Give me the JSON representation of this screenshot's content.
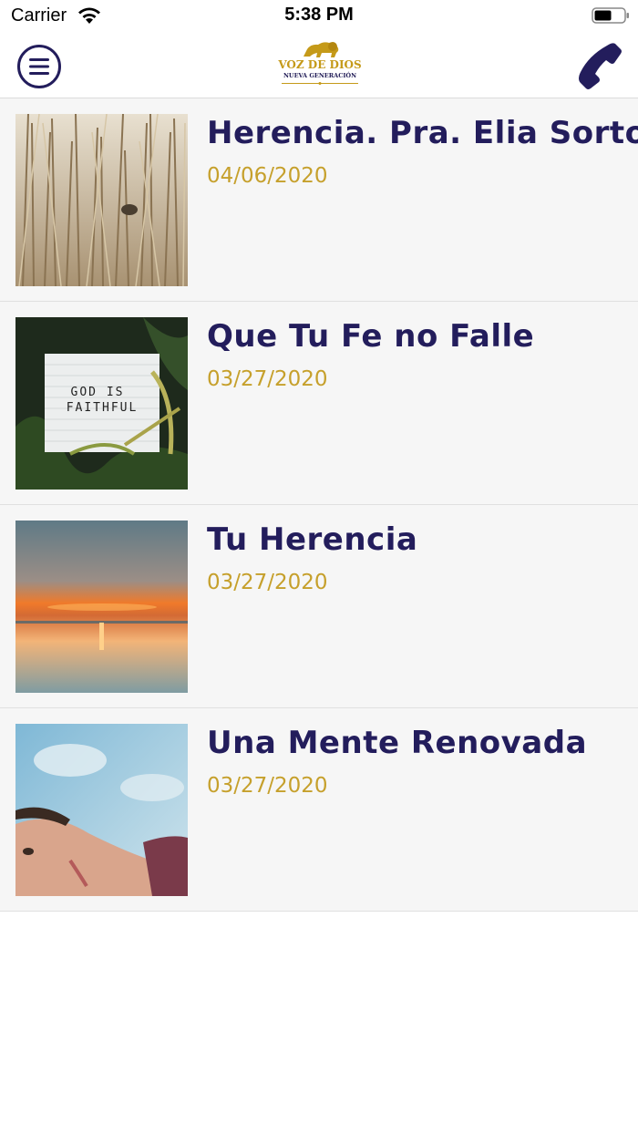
{
  "status_bar": {
    "carrier": "Carrier",
    "time": "5:38 PM"
  },
  "header": {
    "logo_line1": "VOZ DE DIOS",
    "logo_line2": "NUEVA GENERACIÓN",
    "menu_icon": "hamburger-menu-icon",
    "phone_icon": "phone-icon"
  },
  "colors": {
    "title": "#231d5c",
    "date": "#c6a02c",
    "row_bg": "#f6f6f6"
  },
  "items": [
    {
      "title": "Herencia. Pra. Elia Sorto.",
      "date": "04/06/2020"
    },
    {
      "title": "Que Tu Fe no Falle",
      "date": "03/27/2020",
      "image_text_1": "GOD IS",
      "image_text_2": "FAITHFUL"
    },
    {
      "title": "Tu Herencia",
      "date": "03/27/2020"
    },
    {
      "title": "Una Mente Renovada",
      "date": "03/27/2020"
    }
  ]
}
